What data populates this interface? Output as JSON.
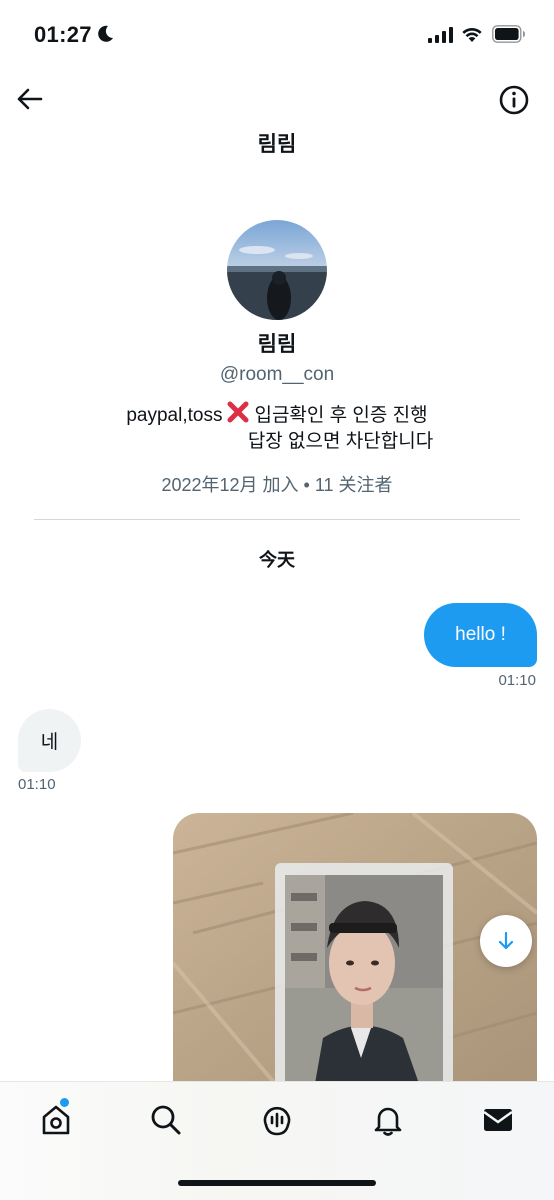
{
  "status_bar": {
    "time": "01:27"
  },
  "header": {
    "title": "림림"
  },
  "profile": {
    "name": "림림",
    "handle": "@room__con",
    "bio_part1": "paypal,toss",
    "bio_part2": "입금확인 후 인증 진행",
    "bio_line2": "답장 없으면 차단합니다",
    "meta": "2022年12月 加入 • 11 关注者"
  },
  "conversation": {
    "date_separator": "今天",
    "messages": [
      {
        "direction": "out",
        "text": "hello !",
        "time": "01:10"
      },
      {
        "direction": "in",
        "text": "네",
        "time": "01:10"
      }
    ]
  },
  "tab_bar": {
    "tabs": [
      "home-icon",
      "search-icon",
      "spaces-icon",
      "bell-icon",
      "envelope-icon"
    ],
    "home_has_badge": true
  },
  "colors": {
    "accent": "#1d9bf0",
    "text_primary": "#0f1419",
    "text_secondary": "#536471",
    "incoming_bubble": "#eff3f4"
  }
}
